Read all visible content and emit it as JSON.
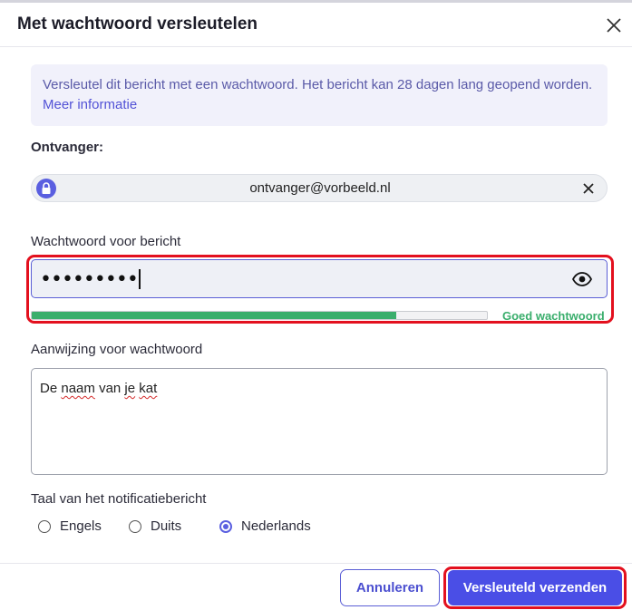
{
  "dialog": {
    "title": "Met wachtwoord versleutelen",
    "close_icon": "close-icon"
  },
  "info": {
    "text": "Versleutel dit bericht met een wachtwoord. Het bericht kan 28 dagen lang geopend worden.",
    "link": "Meer informatie"
  },
  "recipient": {
    "label": "Ontvanger:",
    "email": "ontvanger@vorbeeld.nl",
    "icon": "lock-icon",
    "remove_icon": "close-icon"
  },
  "password": {
    "label": "Wachtwoord voor bericht",
    "value": "•••••••••",
    "toggle_icon": "eye-icon",
    "strength_fraction": 0.8,
    "strength_label": "Goed wachtwoord",
    "strength_color": "#3aae6c"
  },
  "hint": {
    "label": "Aanwijzing voor wachtwoord",
    "value_words": [
      "De",
      "naam",
      "van",
      "je",
      "kat"
    ]
  },
  "language": {
    "label": "Taal van het notificatiebericht",
    "options": [
      "Engels",
      "Duits",
      "Nederlands"
    ],
    "selected": "Nederlands"
  },
  "footer": {
    "cancel_label": "Annuleren",
    "send_label": "Versleuteld verzenden"
  },
  "colors": {
    "accent": "#4a4ee6",
    "highlight": "#e3101e"
  }
}
